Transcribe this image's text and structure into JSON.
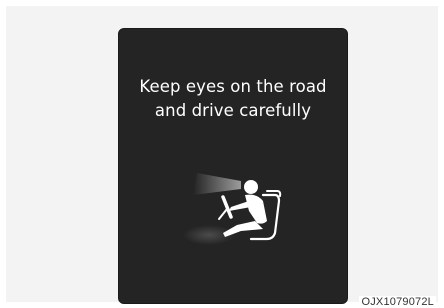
{
  "display": {
    "message_line1": "Keep eyes on the road",
    "message_line2": "and drive carefully",
    "icon": "driver-attention-icon"
  },
  "figure_code": "OJX1079072L",
  "colors": {
    "display_background": "#242424",
    "panel_background": "#f3f3f3",
    "text": "#ffffff"
  }
}
